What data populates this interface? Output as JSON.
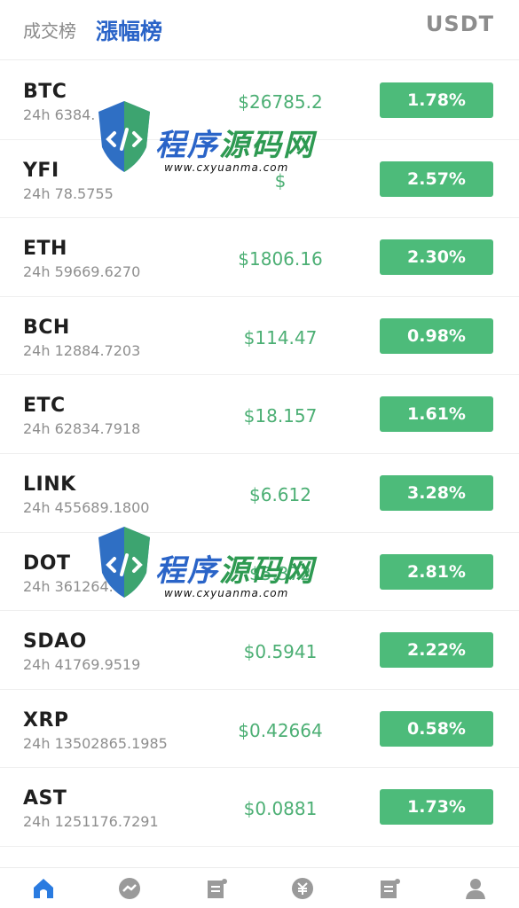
{
  "header": {
    "tabs": [
      {
        "label": "成交榜",
        "active": false
      },
      {
        "label": "漲幅榜",
        "active": true
      }
    ],
    "quote_currency": "USDT"
  },
  "rows": [
    {
      "symbol": "BTC",
      "volume": "24h 6384.",
      "price": "$26785.2",
      "change": "1.78%"
    },
    {
      "symbol": "YFI",
      "volume": "24h 78.5755",
      "price": "$",
      "change": "2.57%"
    },
    {
      "symbol": "ETH",
      "volume": "24h 59669.6270",
      "price": "$1806.16",
      "change": "2.30%"
    },
    {
      "symbol": "BCH",
      "volume": "24h 12884.7203",
      "price": "$114.47",
      "change": "0.98%"
    },
    {
      "symbol": "ETC",
      "volume": "24h 62834.7918",
      "price": "$18.157",
      "change": "1.61%"
    },
    {
      "symbol": "LINK",
      "volume": "24h 455689.1800",
      "price": "$6.612",
      "change": "3.28%"
    },
    {
      "symbol": "DOT",
      "volume": "24h 361264.",
      "price": "$5.372",
      "change": "2.81%"
    },
    {
      "symbol": "SDAO",
      "volume": "24h 41769.9519",
      "price": "$0.5941",
      "change": "2.22%"
    },
    {
      "symbol": "XRP",
      "volume": "24h 13502865.1985",
      "price": "$0.42664",
      "change": "0.58%"
    },
    {
      "symbol": "AST",
      "volume": "24h 1251176.7291",
      "price": "$0.0881",
      "change": "1.73%"
    }
  ],
  "watermark": {
    "text_left": "程序",
    "text_right": "源码网",
    "url": "www.cxyuanma.com"
  },
  "nav": [
    {
      "icon": "home-icon",
      "active": true
    },
    {
      "icon": "market-chart-icon",
      "active": false
    },
    {
      "icon": "orders-icon",
      "active": false
    },
    {
      "icon": "currency-icon",
      "active": false
    },
    {
      "icon": "assets-icon",
      "active": false
    },
    {
      "icon": "profile-icon",
      "active": false
    }
  ],
  "colors": {
    "accent_blue": "#2a64c8",
    "up_green": "#4dbb7a",
    "price_green": "#4caf74",
    "nav_gray": "#9a9a9a",
    "nav_active": "#2a7be0"
  }
}
